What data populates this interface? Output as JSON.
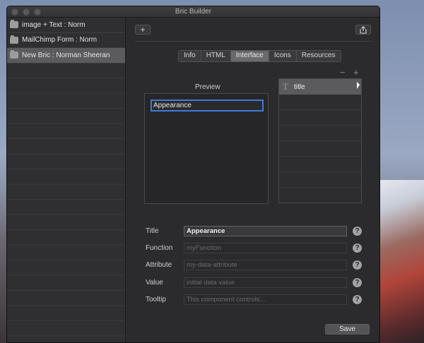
{
  "window": {
    "title": "Bric Builder"
  },
  "sidebar": {
    "items": [
      {
        "label": "image + Text : Norm"
      },
      {
        "label": "MailChimp Form : Norm"
      },
      {
        "label": "New Bric : Norman Sheeran",
        "selected": true
      }
    ]
  },
  "toolbar": {
    "add_label": "+",
    "share_icon": "share-icon"
  },
  "tabs": [
    {
      "label": "Info"
    },
    {
      "label": "HTML"
    },
    {
      "label": "Interface",
      "active": true
    },
    {
      "label": "Icons"
    },
    {
      "label": "Resources"
    }
  ],
  "preview": {
    "label": "Preview",
    "input_value": "Appearance"
  },
  "components": {
    "minus_label": "−",
    "plus_label": "+",
    "items": [
      {
        "label": "title",
        "icon": "text-icon"
      }
    ]
  },
  "form": {
    "title": {
      "label": "Title",
      "value": "Appearance",
      "placeholder": ""
    },
    "function": {
      "label": "Function",
      "value": "",
      "placeholder": "myFunction"
    },
    "attribute": {
      "label": "Attribute",
      "value": "",
      "placeholder": "my-data-attribute"
    },
    "value": {
      "label": "Value",
      "value": "",
      "placeholder": "initial data value"
    },
    "tooltip": {
      "label": "Tooltip",
      "value": "",
      "placeholder": "This component controls..."
    },
    "help_label": "?"
  },
  "actions": {
    "save_label": "Save"
  },
  "colors": {
    "accent": "#3f7ad8",
    "window_bg": "#2b2b2d",
    "sidebar_selected": "#5b5b5d"
  }
}
